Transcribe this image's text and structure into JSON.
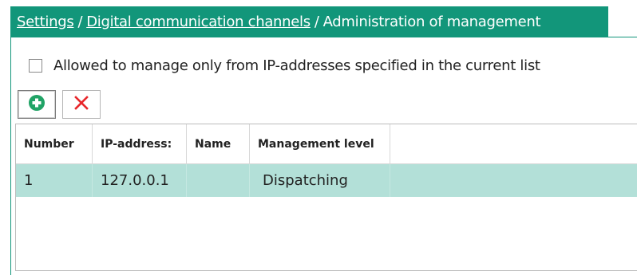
{
  "breadcrumb": {
    "items": [
      {
        "label": "Settings",
        "link": true
      },
      {
        "label": "Digital communication channels",
        "link": true
      },
      {
        "label": "Administration of management",
        "link": false
      }
    ],
    "separator": "/"
  },
  "options": {
    "ip_restriction_label": "Allowed to manage only from IP-addresses specified in the current list",
    "ip_restriction_checked": false
  },
  "toolbar": {
    "add_icon": "plus-circle-icon",
    "delete_icon": "close-x-icon"
  },
  "table": {
    "columns": [
      "Number",
      "IP-address:",
      "Name",
      "Management level"
    ],
    "rows": [
      {
        "number": "1",
        "ip": "127.0.0.1",
        "name": "",
        "level": "Dispatching"
      }
    ]
  },
  "colors": {
    "accent": "#12967a",
    "selected_row": "#b3e0d8",
    "add_green": "#21a366",
    "delete_red": "#e8262a"
  }
}
